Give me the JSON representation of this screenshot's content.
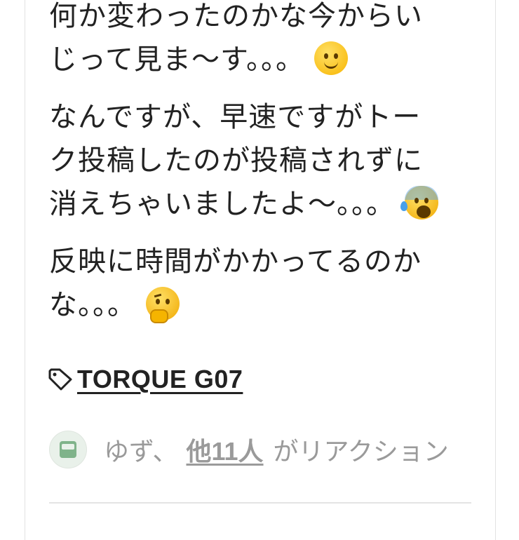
{
  "post": {
    "paragraphs": [
      {
        "lines": [
          "何か変わったのかな今からい",
          "じって見ま〜す。。。"
        ],
        "emoji": "smiling-face-emoji"
      },
      {
        "lines": [
          "なんですが、早速ですがトー",
          "ク投稿したのが投稿されずに",
          "消えちゃいましたよ〜。。。"
        ],
        "emoji": "anxious-sweat-face-emoji"
      },
      {
        "lines": [
          "反映に時間がかかってるのか",
          "な。。。"
        ],
        "emoji": "thinking-face-emoji"
      }
    ]
  },
  "tag": {
    "icon": "tag-icon",
    "label": "TORQUE G07"
  },
  "reactions": {
    "avatar": "user-avatar",
    "who": "ゆず、",
    "others_label": "他11人",
    "suffix": "がリアクション"
  }
}
